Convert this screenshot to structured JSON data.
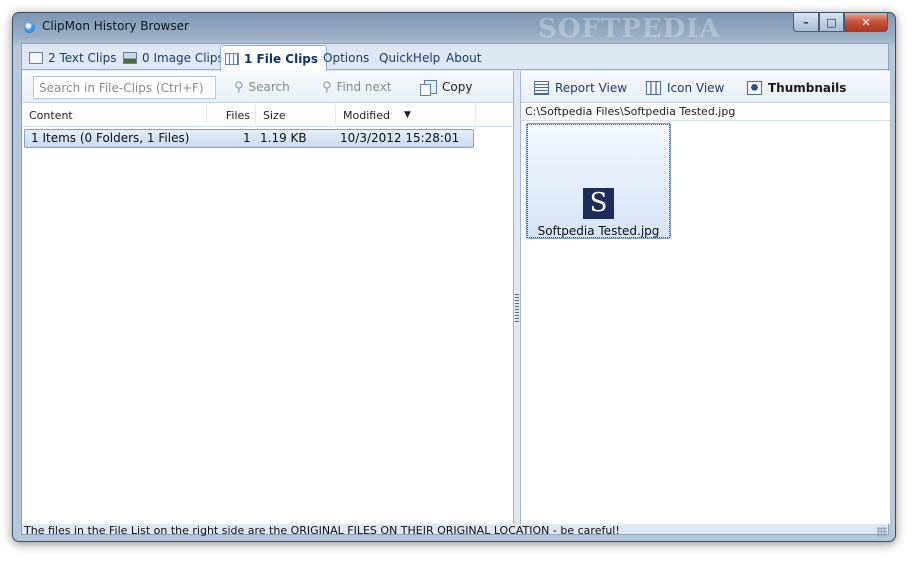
{
  "window": {
    "title": "ClipMon History Browser",
    "watermark": "SOFTPEDIA"
  },
  "controls": {
    "minimize": "–",
    "maximize": "□",
    "close": "✕"
  },
  "tabs": [
    {
      "label": "2 Text Clips"
    },
    {
      "label": "0 Image Clips"
    },
    {
      "label": "1 File Clips"
    },
    {
      "label": "Options"
    },
    {
      "label": "QuickHelp"
    },
    {
      "label": "About"
    }
  ],
  "left_toolbar": {
    "search_placeholder": "Search in File-Clips (Ctrl+F)",
    "search_label": "Search",
    "find_next_label": "Find next",
    "copy_label": "Copy"
  },
  "list": {
    "columns": [
      "Content",
      "Files",
      "Size",
      "Modified"
    ],
    "rows": [
      {
        "content": "1 Items (0 Folders, 1 Files)",
        "files": "1",
        "size": "1.19 KB",
        "modified": "10/3/2012 15:28:01"
      }
    ]
  },
  "right_toolbar": {
    "report_view": "Report View",
    "icon_view": "Icon View",
    "thumbnails": "Thumbnails"
  },
  "file_view": {
    "path": "C:\\Softpedia Files\\Softpedia Tested.jpg",
    "items": [
      {
        "thumb_letter": "S",
        "name": "Softpedia Tested.jpg"
      }
    ]
  },
  "status": {
    "text": "The files in the File List on the right side are the ORIGINAL FILES ON THEIR ORIGINAL LOCATION - be careful!"
  }
}
